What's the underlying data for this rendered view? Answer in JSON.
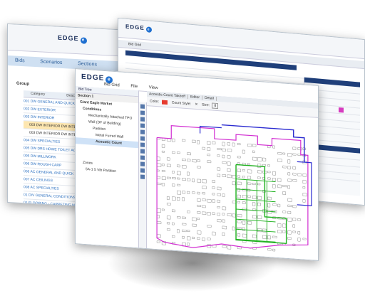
{
  "w1": {
    "logo": "EDGE",
    "tabs": [
      "Bids",
      "Scenarios",
      "Sections"
    ],
    "group_label": "Group",
    "headers": [
      "Category",
      "Descr"
    ],
    "rows": [
      {
        "text": "001 DW GENERAL AND QUICK E",
        "sub": false,
        "sel": false
      },
      {
        "text": "002 DW EXTERIOR",
        "sub": false,
        "sel": false
      },
      {
        "text": "003 DW INTERIOR",
        "sub": false,
        "sel": false
      },
      {
        "text": "003 DW INTERIOR DW INTER",
        "sub": true,
        "sel": true
      },
      {
        "text": "003 DW INTERIOR DW INTERIOR",
        "sub": true,
        "sel": false
      },
      {
        "text": "004 DW SPECIALTIES",
        "sub": false,
        "sel": false
      },
      {
        "text": "005 DW DRS HDWE TOILET ACC",
        "sub": false,
        "sel": false
      },
      {
        "text": "005 DW MILLWORK",
        "sub": false,
        "sel": false
      },
      {
        "text": "006 DW ROUGH CARP",
        "sub": false,
        "sel": false
      },
      {
        "text": "006 AC GENERAL AND QUICK E",
        "sub": false,
        "sel": false
      },
      {
        "text": "007 AC CEILINGS",
        "sub": false,
        "sel": false
      },
      {
        "text": "008 AC SPECIALTIES",
        "sub": false,
        "sel": false
      },
      {
        "text": "01 DIV GENERAL CONDITIONS",
        "sub": false,
        "sel": false
      },
      {
        "text": "01 FLOORING - CARPETING HON",
        "sub": false,
        "sel": false
      }
    ]
  },
  "w2": {
    "logo": "EDGE",
    "title": "Bid Grid"
  },
  "w3": {
    "logo": "EDGE",
    "menu": [
      "Bid Grid",
      "File",
      "View"
    ],
    "tree_title": "Bid Tree",
    "section": "Section 1",
    "nodes": [
      "Giant Eagle Market",
      "Conditions",
      "Mechanically Attached TPO",
      "Wall (DF of Building)",
      "Partition",
      "Metal Furred Wall",
      "Acoustic Count",
      "Zones",
      "5A-1 5 Vib Partition"
    ],
    "doc_tabs": [
      "Acoustic Count Takeoff",
      "Editor",
      "Detail"
    ],
    "color_label": "Color:",
    "count_style_label": "Count Style:",
    "size_label": "Size:",
    "size_value": "8",
    "accent": "#e63a2e",
    "plan_colors": {
      "magenta": "#d22fd2",
      "blue": "#2a2ad0",
      "green": "#1eb01e",
      "grey": "#777"
    }
  }
}
